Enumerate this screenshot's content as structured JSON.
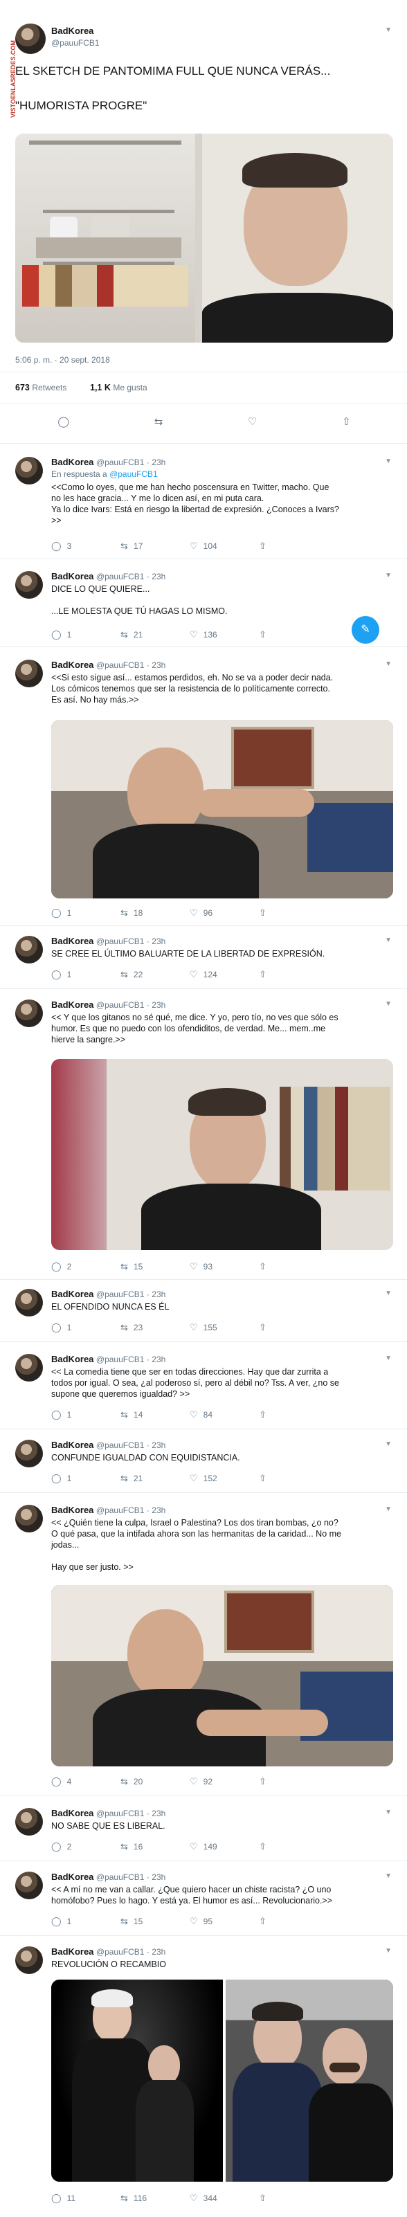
{
  "watermark": "VISTOENLASREDES.COM",
  "main": {
    "name": "BadKorea",
    "handle": "@pauuFCB1",
    "line1": "EL SKETCH DE PANTOMIMA FULL QUE NUNCA VERÁS...",
    "line2": "\"HUMORISTA PROGRE\"",
    "timestamp": "5:06 p. m. · 20 sept. 2018",
    "retweets_count": "673",
    "retweets_label": "Retweets",
    "likes_count": "1,1 K",
    "likes_label": "Me gusta"
  },
  "replies": [
    {
      "name": "BadKorea",
      "handle": "@pauuFCB1",
      "time": "· 23h",
      "reply_to_prefix": "En respuesta a",
      "reply_to": "@pauuFCB1",
      "text": "<<Como lo oyes, que me han hecho poscensura en Twitter, macho. Que\nno les hace gracia... Y me lo dicen así, en mi puta cara.\nYa lo dice Ivars: Está en riesgo la libertad de expresión. ¿Conoces a Ivars?\n>>",
      "replies": "3",
      "retweets": "17",
      "likes": "104"
    },
    {
      "name": "BadKorea",
      "handle": "@pauuFCB1",
      "time": "· 23h",
      "text": "DICE LO QUE QUIERE...\n\n...LE MOLESTA QUE TÚ HAGAS LO MISMO.",
      "replies": "1",
      "retweets": "21",
      "likes": "136"
    },
    {
      "name": "BadKorea",
      "handle": "@pauuFCB1",
      "time": "· 23h",
      "text": "<<Si esto sigue así... estamos perdidos, eh. No se va a poder decir nada.\nLos cómicos tenemos que ser la resistencia de lo políticamente correcto.\nEs así. No hay más.>>",
      "replies": "1",
      "retweets": "18",
      "likes": "96"
    },
    {
      "name": "BadKorea",
      "handle": "@pauuFCB1",
      "time": "· 23h",
      "text": "SE CREE EL ÚLTIMO BALUARTE DE LA LIBERTAD DE EXPRESIÓN.",
      "replies": "1",
      "retweets": "22",
      "likes": "124"
    },
    {
      "name": "BadKorea",
      "handle": "@pauuFCB1",
      "time": "· 23h",
      "text": "<< Y que los gitanos no sé qué, me dice. Y yo, pero tío, no ves que sólo es\nhumor. Es que no puedo con los ofendiditos, de verdad. Me... mem..me\nhierve la sangre.>>",
      "replies": "2",
      "retweets": "15",
      "likes": "93"
    },
    {
      "name": "BadKorea",
      "handle": "@pauuFCB1",
      "time": "· 23h",
      "text": "EL OFENDIDO NUNCA ES ÉL",
      "replies": "1",
      "retweets": "23",
      "likes": "155"
    },
    {
      "name": "BadKorea",
      "handle": "@pauuFCB1",
      "time": "· 23h",
      "text": "<< La comedia tiene que ser en todas direcciones. Hay que dar zurrita a\ntodos por igual. O sea, ¿al poderoso sí, pero al débil no? Tss. A ver, ¿no se\nsupone que queremos igualdad? >>",
      "replies": "1",
      "retweets": "14",
      "likes": "84"
    },
    {
      "name": "BadKorea",
      "handle": "@pauuFCB1",
      "time": "· 23h",
      "text": "CONFUNDE IGUALDAD CON EQUIDISTANCIA.",
      "replies": "1",
      "retweets": "21",
      "likes": "152"
    },
    {
      "name": "BadKorea",
      "handle": "@pauuFCB1",
      "time": "· 23h",
      "text": "<< ¿Quién tiene la culpa, Israel o Palestina? Los dos tiran bombas, ¿o no?\nO qué pasa, que la intifada ahora son las hermanitas de la caridad... No me\njodas...\n\nHay que ser justo. >>",
      "replies": "4",
      "retweets": "20",
      "likes": "92"
    },
    {
      "name": "BadKorea",
      "handle": "@pauuFCB1",
      "time": "· 23h",
      "text": "NO SABE QUE ES LIBERAL.",
      "replies": "2",
      "retweets": "16",
      "likes": "149"
    },
    {
      "name": "BadKorea",
      "handle": "@pauuFCB1",
      "time": "· 23h",
      "text": "<< A mí no me van a callar. ¿Que quiero hacer un chiste racista? ¿O uno\nhomófobo? Pues lo hago. Y está ya. El humor es así... Revolucionario.>>",
      "replies": "1",
      "retweets": "15",
      "likes": "95"
    },
    {
      "name": "BadKorea",
      "handle": "@pauuFCB1",
      "time": "· 23h",
      "text": "REVOLUCIÓN O RECAMBIO",
      "replies": "11",
      "retweets": "116",
      "likes": "344"
    }
  ],
  "icons": {
    "reply": "reply-icon",
    "retweet": "retweet-icon",
    "like": "heart-icon",
    "share": "share-icon",
    "chevron": "chevron-down-icon"
  },
  "colors": {
    "accent": "#1da1f2",
    "text": "#14171a",
    "muted": "#657786",
    "border": "#e6ecf0"
  }
}
